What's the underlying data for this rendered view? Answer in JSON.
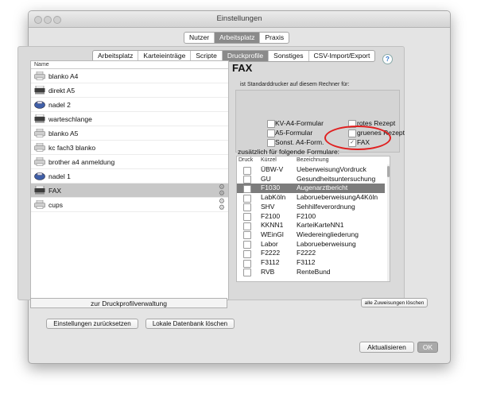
{
  "window": {
    "title": "Einstellungen"
  },
  "main_tabs": [
    {
      "label": "Nutzer",
      "selected": false
    },
    {
      "label": "Arbeitsplatz",
      "selected": true
    },
    {
      "label": "Praxis",
      "selected": false
    }
  ],
  "sub_tabs": [
    {
      "label": "Arbeitsplatz",
      "selected": false
    },
    {
      "label": "Karteieinträge",
      "selected": false
    },
    {
      "label": "Scripte",
      "selected": false
    },
    {
      "label": "Druckprofile",
      "selected": true
    },
    {
      "label": "Sonstiges",
      "selected": false
    },
    {
      "label": "CSV-Import/Export",
      "selected": false
    }
  ],
  "profiles": {
    "header": "Name",
    "items": [
      {
        "label": "blanko A4",
        "icon": "printer-icon"
      },
      {
        "label": "direkt A5",
        "icon": "dot-matrix-printer-icon"
      },
      {
        "label": "nadel 2",
        "icon": "network-printer-icon"
      },
      {
        "label": "warteschlange",
        "icon": "dot-matrix-printer-icon"
      },
      {
        "label": "blanko A5",
        "icon": "printer-icon"
      },
      {
        "label": "kc fach3 blanko",
        "icon": "printer-icon"
      },
      {
        "label": "brother a4 anmeldung",
        "icon": "printer-icon"
      },
      {
        "label": "nadel 1",
        "icon": "network-printer-icon"
      },
      {
        "label": "FAX",
        "icon": "dot-matrix-printer-icon",
        "selected": true
      },
      {
        "label": "cups",
        "icon": "printer-icon"
      }
    ],
    "manage_button": "zur Druckprofilverwaltung"
  },
  "detail": {
    "title": "FAX",
    "help_label": "?",
    "std_caption": "ist Standarddrucker auf diesem Rechner für:",
    "std_options": [
      {
        "label": "KV-A4-Formular",
        "checked": false
      },
      {
        "label": "A5-Formular",
        "checked": false
      },
      {
        "label": "Sonst. A4-Form.",
        "checked": false
      },
      {
        "label": "rotes Rezept",
        "checked": false
      },
      {
        "label": "gruenes Rezept",
        "checked": false
      },
      {
        "label": "FAX",
        "checked": true
      }
    ],
    "additional_caption": "zusätzlich für folgende Formulare:",
    "columns": [
      "Druck",
      "Kürzel",
      "Bezeichnung"
    ],
    "rows": [
      {
        "kuerzel": "ÜBW-V",
        "bezeichnung": "UeberweisungVordruck",
        "selected": false
      },
      {
        "kuerzel": "GU",
        "bezeichnung": "Gesundheitsuntersuchung",
        "selected": false
      },
      {
        "kuerzel": "F1030",
        "bezeichnung": "Augenarztbericht",
        "selected": true
      },
      {
        "kuerzel": "LabKöln",
        "bezeichnung": "LaborueberweisungA4Köln",
        "selected": false
      },
      {
        "kuerzel": "SHV",
        "bezeichnung": "Sehhilfeverordnung",
        "selected": false
      },
      {
        "kuerzel": "F2100",
        "bezeichnung": "F2100",
        "selected": false
      },
      {
        "kuerzel": "KKNN1",
        "bezeichnung": "KarteiKarteNN1",
        "selected": false
      },
      {
        "kuerzel": "WEinGl",
        "bezeichnung": "Wiedereingliederung",
        "selected": false
      },
      {
        "kuerzel": "Labor",
        "bezeichnung": "Laborueberweisung",
        "selected": false
      },
      {
        "kuerzel": "F2222",
        "bezeichnung": "F2222",
        "selected": false
      },
      {
        "kuerzel": "F3112",
        "bezeichnung": "F3112",
        "selected": false
      },
      {
        "kuerzel": "RVB",
        "bezeichnung": "RenteBund",
        "selected": false
      }
    ],
    "clear_button": "alle Zuweisungen löschen"
  },
  "footer": {
    "reset_button": "Einstellungen zurücksetzen",
    "delete_db_button": "Lokale Datenbank löschen",
    "update_button": "Aktualisieren",
    "ok_button": "OK"
  },
  "colors": {
    "annotation_circle": "#e02020",
    "ok_button": "#a9a9a9"
  }
}
